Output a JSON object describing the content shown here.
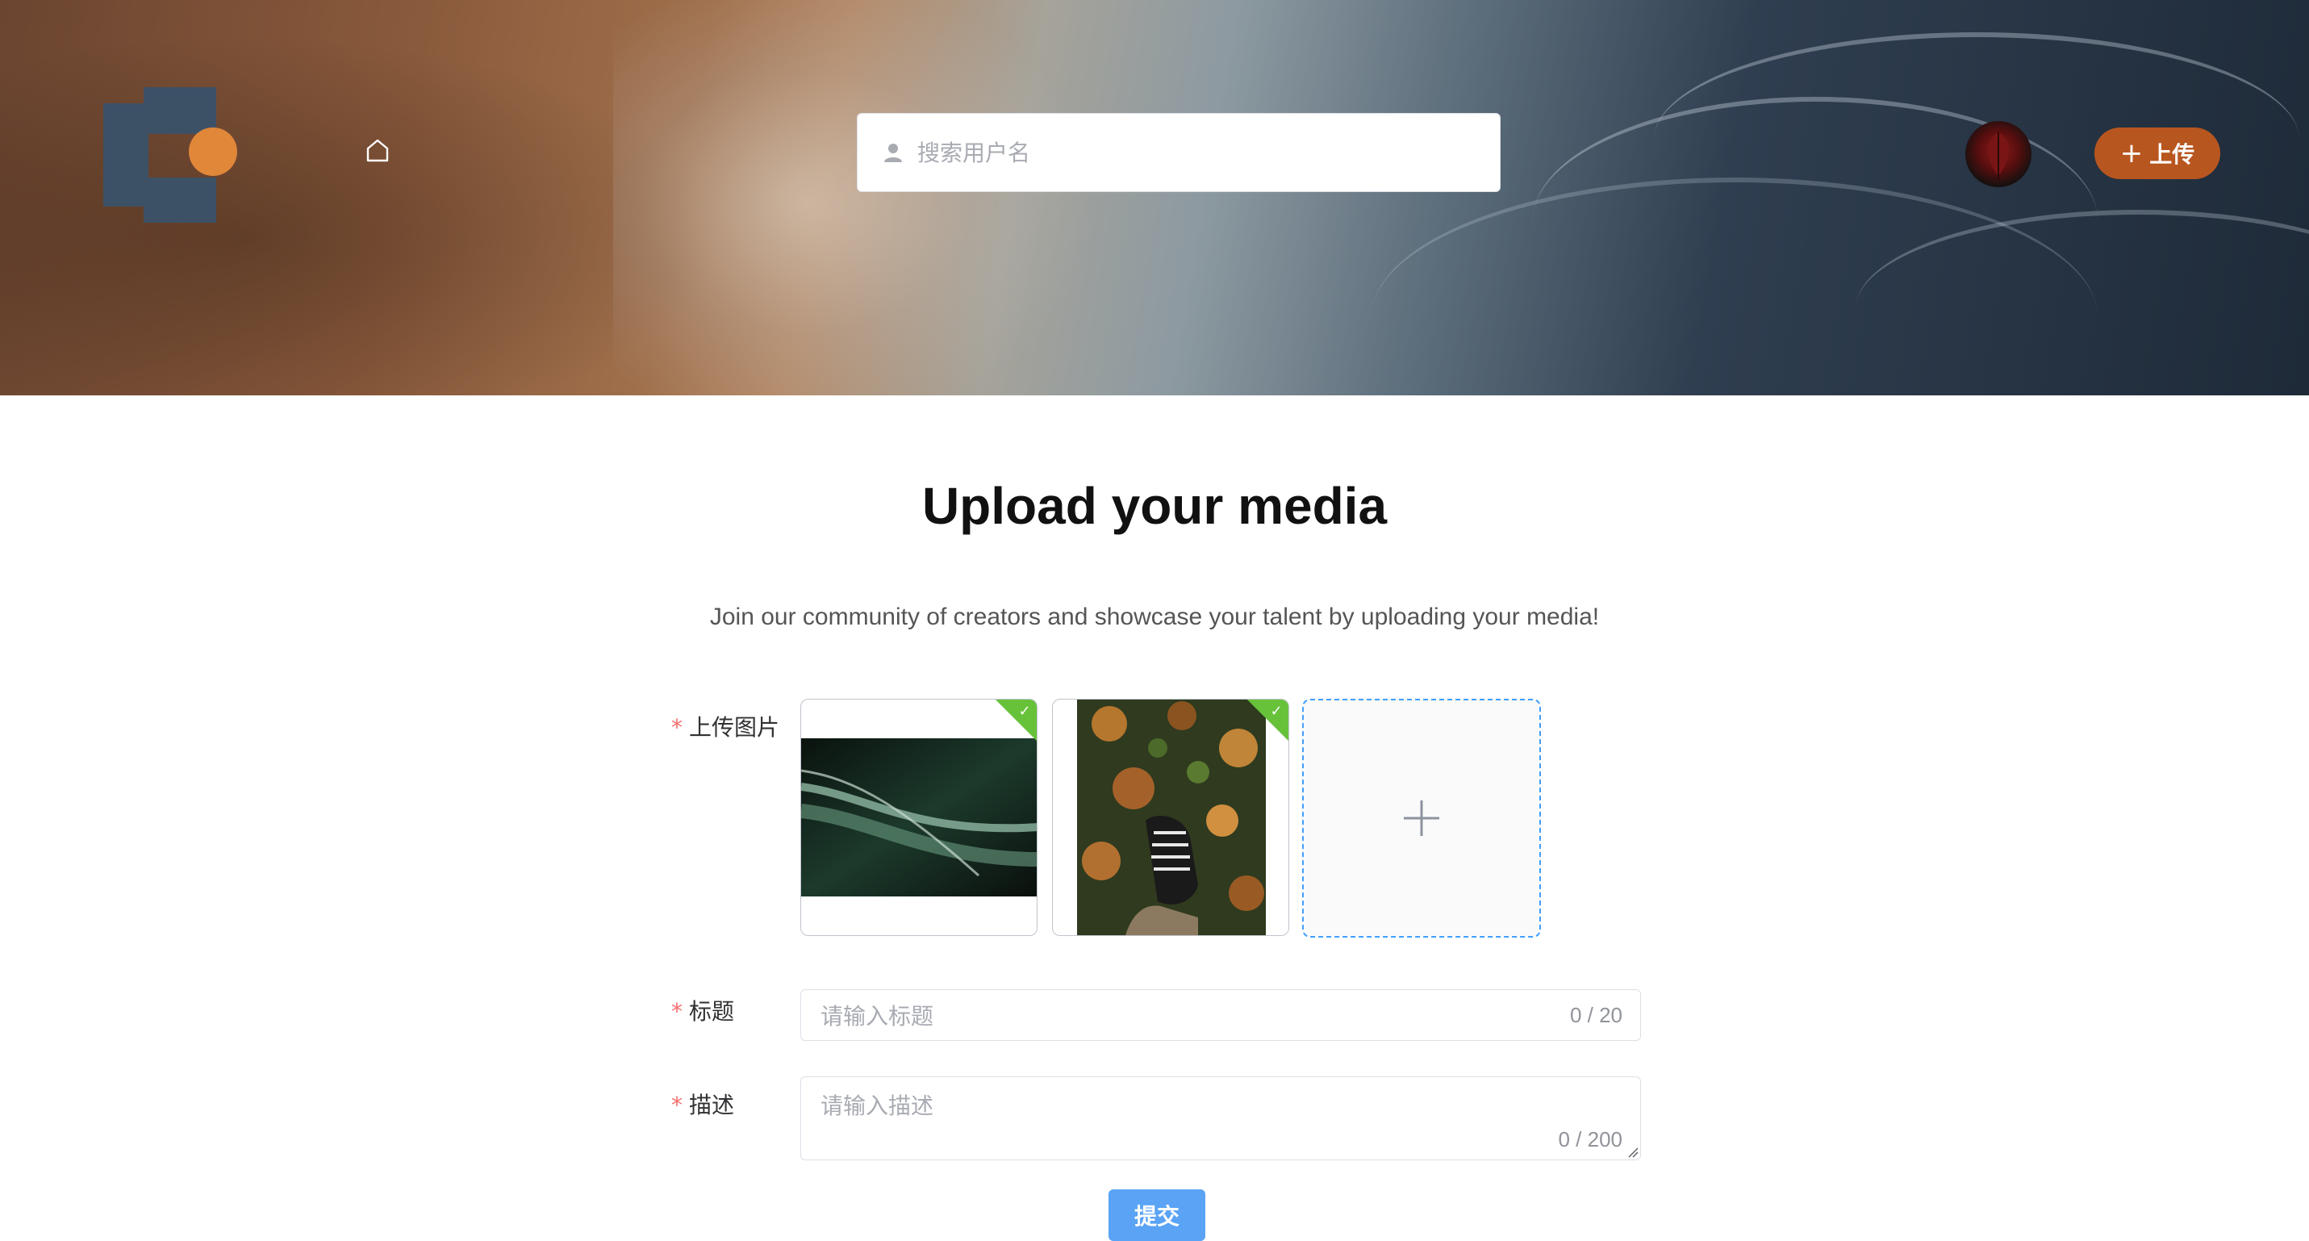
{
  "header": {
    "search_placeholder": "搜索用户名",
    "upload_button_label": "上传",
    "icons": {
      "home": "home-icon",
      "search": "user-icon",
      "upload": "plus-icon"
    }
  },
  "main": {
    "title": "Upload your media",
    "subtitle": "Join our community of creators and showcase your talent by uploading your media!"
  },
  "form": {
    "required_mark": "*",
    "images_label": "上传图片",
    "title_label": "标题",
    "title_placeholder": "请输入标题",
    "title_counter": "0 / 20",
    "description_label": "描述",
    "description_placeholder": "请输入描述",
    "description_counter": "0 / 200",
    "submit_label": "提交"
  },
  "colors": {
    "accent_orange": "#b8561f",
    "success_green": "#67c23a",
    "primary_blue": "#409eff",
    "required_red": "#f56c6c"
  }
}
